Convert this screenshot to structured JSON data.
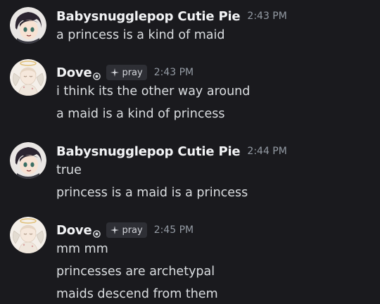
{
  "colors": {
    "background": "#1a1a1e",
    "username": "#f2f3f5",
    "text": "#dbdee1",
    "timestamp": "#949ba4",
    "tag_bg": "#2e2f35"
  },
  "messages": [
    {
      "author": "Babysnugglepop Cutie Pie",
      "timestamp": "2:43 PM",
      "avatar_icon": "anime-girl-avatar",
      "lines": [
        "a princess is a kind of maid"
      ]
    },
    {
      "author": "Dove",
      "status_icon": "spiral-icon",
      "tag_icon": "sparkle-icon",
      "tag": "pray",
      "timestamp": "2:43 PM",
      "avatar_icon": "angel-halo-avatar",
      "lines": [
        "i think its the other way around",
        "a maid is a kind of princess"
      ]
    },
    {
      "author": "Babysnugglepop Cutie Pie",
      "timestamp": "2:44 PM",
      "avatar_icon": "anime-girl-avatar",
      "lines": [
        "true",
        "princess is a maid is a princess"
      ]
    },
    {
      "author": "Dove",
      "status_icon": "spiral-icon",
      "tag_icon": "sparkle-icon",
      "tag": "pray",
      "timestamp": "2:45 PM",
      "avatar_icon": "angel-halo-avatar",
      "lines": [
        "mm mm",
        "princesses are archetypal",
        "maids descend from them"
      ]
    }
  ]
}
